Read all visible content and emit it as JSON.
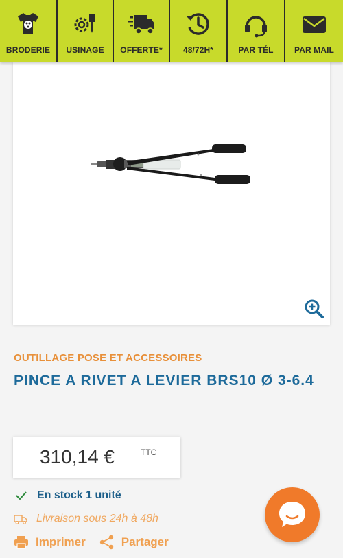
{
  "topbar": {
    "items": [
      {
        "label": "BRODERIE",
        "icon": "tshirt-palette-icon"
      },
      {
        "label": "USINAGE",
        "icon": "gear-tools-icon"
      },
      {
        "label": "OFFERTE*",
        "icon": "delivery-truck-icon"
      },
      {
        "label": "48/72H*",
        "icon": "clock-history-icon"
      },
      {
        "label": "PAR TÉL",
        "icon": "headset-icon"
      },
      {
        "label": "PAR MAIL",
        "icon": "envelope-icon"
      }
    ],
    "bg_color": "#c8da2b"
  },
  "product": {
    "image_icon": "rivet-tool-image",
    "category": "OUTILLAGE POSE ET ACCESSOIRES",
    "title": "PINCE A RIVET A LEVIER BRS10 Ø 3-6.4",
    "price": "310,14 €",
    "price_suffix": "TTC",
    "stock": "En stock 1 unité",
    "delivery": "Livraison sous 24h à 48h"
  },
  "actions": {
    "print_label": "Imprimer",
    "share_label": "Partager"
  },
  "colors": {
    "accent_orange": "#f07a2a",
    "title_blue": "#1d6a9a",
    "category_orange": "#e8903a"
  }
}
